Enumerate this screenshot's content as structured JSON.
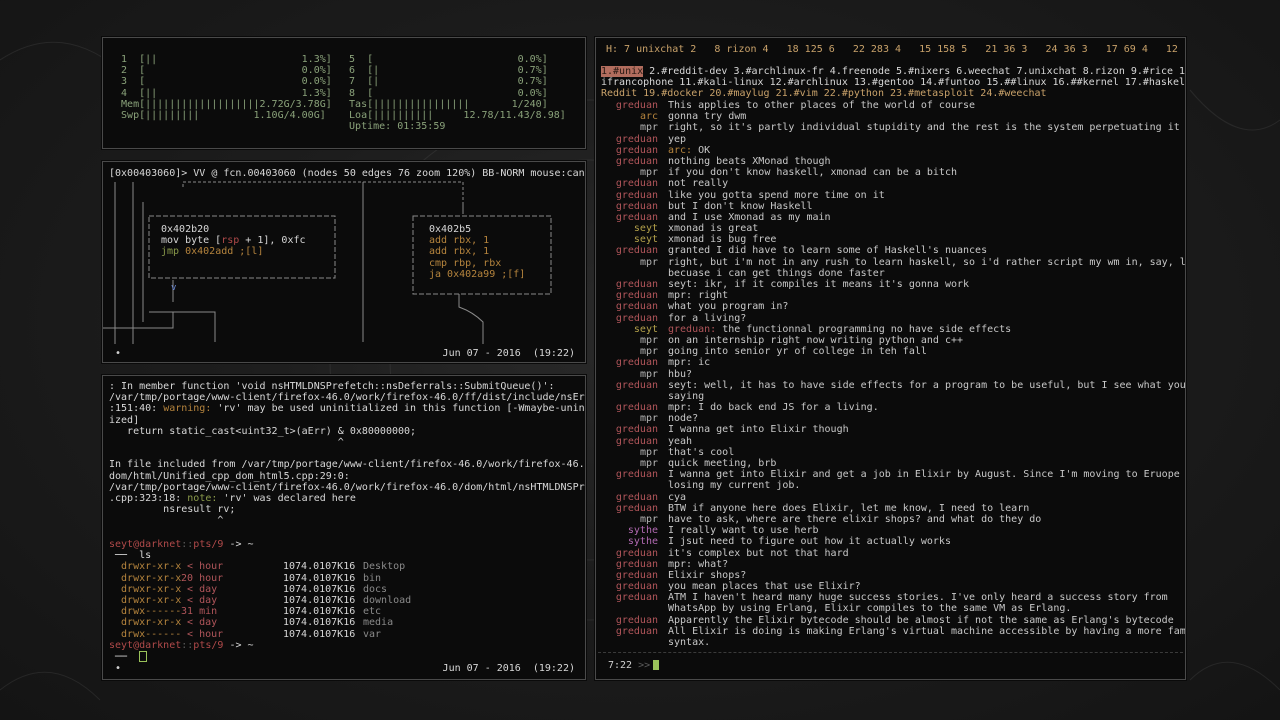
{
  "htop": {
    "rows": [
      {
        "left": "  1  [||                        1.3%]",
        "right": "  5  [                        0.0%]"
      },
      {
        "left": "  2  [                          0.0%]",
        "right": "  6  [|                       0.7%]"
      },
      {
        "left": "  3  [                          0.0%]",
        "right": "  7  [|                       0.7%]"
      },
      {
        "left": "  4  [||                        1.3%]",
        "right": "  8  [                        0.0%]"
      },
      {
        "left": "  Mem[|||||||||||||||||||2.72G/3.78G]",
        "right": "  Tas[||||||||||||||||       1/240]"
      },
      {
        "left": "  Swp[|||||||||         1.10G/4.00G]",
        "right": "  Loa[||||||||||     12.78/11.43/8.98]"
      },
      {
        "left": "",
        "right": "  Uptime: 01:35:59"
      }
    ]
  },
  "r2": {
    "header": "[0x00403060]> VV @ fcn.00403060 (nodes 50 edges 76 zoom 120%) BB-NORM mouse:canvas-y",
    "node1": {
      "addr": "0x402b20",
      "line1a": "mov byte [",
      "line1b": "rsp",
      "line1c": " + 1], 0xfc",
      "line2a": "jmp ",
      "line2b": "0x402add ;[l]"
    },
    "node2": {
      "addr": "0x402b5",
      "l1": "add rbx, 1",
      "l2": "add rbx, 1",
      "l3": "cmp rbp, rbx",
      "l4": "ja 0x402a99 ;[f]"
    },
    "status_left": "•",
    "status_right": "Jun 07 - 2016  (19:22)"
  },
  "term": {
    "lines": [
      {
        "text": ": In member function 'void nsHTMLDNSPrefetch::nsDeferrals::SubmitQueue()':"
      },
      {
        "text": "/var/tmp/portage/www-client/firefox-46.0/work/firefox-46.0/ff/dist/include/nsError.h"
      },
      {
        "pre": ":151:40: ",
        "warn": "warning:",
        "post": " 'rv' may be used uninitialized in this function [-Wmaybe-uninitial"
      },
      {
        "text": "ized]"
      },
      {
        "text": "   return static_cast<uint32_t>(aErr) & 0x80000000;"
      },
      {
        "text": "                                      ^"
      },
      {
        "text": "In file included from /var/tmp/portage/www-client/firefox-46.0/work/firefox-46.0/ff/"
      },
      {
        "text": "dom/html/Unified_cpp_dom_html5.cpp:29:0:"
      },
      {
        "text": "/var/tmp/portage/www-client/firefox-46.0/work/firefox-46.0/dom/html/nsHTMLDNSPrefetch"
      },
      {
        "pre": ".cpp:323:18: ",
        "note": "note:",
        "post": " 'rv' was declared here"
      },
      {
        "text": "         nsresult rv;"
      },
      {
        "text": "                  ^"
      }
    ],
    "prompt1": {
      "user": "seyt@darknet",
      "sep": "::",
      "path": "pts/9",
      "tail": "-> ~"
    },
    "prompt_cmd": " ──  ls",
    "ls": [
      {
        "perm": "  drwxr-xr-x",
        "age": "  < hour",
        "size": "1074.0107K16",
        "name": "Desktop"
      },
      {
        "perm": "  drwxr-xr-x",
        "age": " 20 hour",
        "size": "1074.0107K16",
        "name": "bin"
      },
      {
        "perm": "  drwxr-xr-x",
        "age": "  < day",
        "size": "1074.0107K16",
        "name": "docs"
      },
      {
        "perm": "  drwxr-xr-x",
        "age": "  < day",
        "size": "1074.0107K16",
        "name": "download"
      },
      {
        "perm": "  drwx------",
        "age": " 31 min",
        "size": "1074.0107K16",
        "name": "etc"
      },
      {
        "perm": "  drwxr-xr-x",
        "age": "  < day",
        "size": "1074.0107K16",
        "name": "media"
      },
      {
        "perm": "  drwx------",
        "age": "  < hour",
        "size": "1074.0107K16",
        "name": "var"
      }
    ],
    "prompt2": {
      "user": "seyt@darknet",
      "sep": "::",
      "path": "pts/9",
      "tail": "-> ~"
    },
    "prompt2_cmd": " ──  ",
    "status_left": "•",
    "status_right": "Jun 07 - 2016  (19:22)"
  },
  "irc": {
    "topbar": "H: 7 unixchat 2   8 rizon 4   18 125 6   22 283 4   15 158 5   21 36 3   24 36 3   17 69 4   12 1 ++",
    "channels_line1": [
      {
        "label": "1.#unix",
        "active": true
      },
      {
        "label": " 2.#reddit-dev"
      },
      {
        "label": " 3.#archlinux-fr"
      },
      {
        "label": " 4.freenode"
      },
      {
        "label": " 5.#nixers"
      },
      {
        "label": " 6.weechat"
      },
      {
        "label": " 7.unixchat"
      },
      {
        "label": " 8.rizon"
      },
      {
        "label": " 9.#rice"
      },
      {
        "label": " 10.#kal"
      }
    ],
    "channels_line2": "ifrancophone 11.#kali-linux 12.#archlinux 13.#gentoo 14.#funtoo 15.##linux 16.##kernel 17.#haskell 18.#",
    "channels_line3": "Reddit 19.#docker 20.#maylug 21.#vim 22.#python 23.#metasploit 24.#weechat",
    "messages": [
      {
        "nick": "greduan",
        "text": "This applies to other places of the world of course"
      },
      {
        "nick": "arc",
        "text": "gonna try dwm"
      },
      {
        "nick": "mpr",
        "text": "right, so it's partly individual stupidity and the rest is the system perpetuating it"
      },
      {
        "nick": "greduan",
        "text": "yep"
      },
      {
        "nick": "greduan",
        "hl": "arc:",
        "text": " OK"
      },
      {
        "nick": "greduan",
        "text": "nothing beats XMonad though"
      },
      {
        "nick": "mpr",
        "text": "if you don't know haskell, xmonad can be a bitch"
      },
      {
        "nick": "greduan",
        "text": "not really"
      },
      {
        "nick": "greduan",
        "text": "like you gotta spend more time on it"
      },
      {
        "nick": "greduan",
        "text": "but I don't know Haskell"
      },
      {
        "nick": "greduan",
        "text": "and I use Xmonad as my main"
      },
      {
        "nick": "seyt",
        "text": "xmonad is great"
      },
      {
        "nick": "seyt",
        "text": "xmonad is bug free"
      },
      {
        "nick": "greduan",
        "text": "granted I did have to learn some of Haskell's nuances"
      },
      {
        "nick": "mpr",
        "text": "right, but i'm not in any rush to learn haskell, so i'd rather script my wm in, say, lisp",
        "cont": "becuase i can get things done faster"
      },
      {
        "nick": "greduan",
        "text": "seyt: ikr, if it compiles it means it's gonna work"
      },
      {
        "nick": "greduan",
        "text": "mpr: right"
      },
      {
        "nick": "greduan",
        "text": "what you program in?"
      },
      {
        "nick": "greduan",
        "text": "for a living?"
      },
      {
        "nick": "seyt",
        "hl": "greduan:",
        "text": " the functionnal programming no have side effects"
      },
      {
        "nick": "mpr",
        "text": "on an internship right now writing python and c++"
      },
      {
        "nick": "mpr",
        "text": "going into senior yr of college in teh fall"
      },
      {
        "nick": "greduan",
        "text": "mpr: ic"
      },
      {
        "nick": "mpr",
        "text": "hbu?"
      },
      {
        "nick": "greduan",
        "text": "seyt: well, it has to have side effects for a program to be useful, but I see what you're",
        "cont": "saying"
      },
      {
        "nick": "greduan",
        "text": "mpr: I do back end JS for a living."
      },
      {
        "nick": "mpr",
        "text": "node?"
      },
      {
        "nick": "greduan",
        "text": "I wanna get into Elixir though"
      },
      {
        "nick": "greduan",
        "text": "yeah"
      },
      {
        "nick": "mpr",
        "text": "that's cool"
      },
      {
        "nick": "mpr",
        "text": "quick meeting, brb"
      },
      {
        "nick": "greduan",
        "text": "I wanna get into Elixir and get a job in Elixir by August. Since I'm moving to Eruope I'm",
        "cont": "losing my current job."
      },
      {
        "nick": "greduan",
        "text": "cya"
      },
      {
        "nick": "greduan",
        "text": "BTW if anyone here does Elixir, let me know, I need to learn"
      },
      {
        "nick": "mpr",
        "text": "have to ask, where are there elixir shops? and what do they do"
      },
      {
        "nick": "sythe",
        "text": "I really want to use herb"
      },
      {
        "nick": "sythe",
        "text": "I jsut need to figure out how it actually works"
      },
      {
        "nick": "greduan",
        "text": "it's complex but not that hard"
      },
      {
        "nick": "greduan",
        "text": "mpr: what?"
      },
      {
        "nick": "greduan",
        "text": "Elixir shops?"
      },
      {
        "nick": "greduan",
        "text": "you mean places that use Elixir?"
      },
      {
        "nick": "greduan",
        "text": "ATM I haven't heard many huge success stories. I've only heard a success story from",
        "cont": "WhatsApp by using Erlang, Elixir compiles to the same VM as Erlang."
      },
      {
        "nick": "greduan",
        "text": "Apparently the Elixir bytecode should be almost if not the same as Erlang's bytecode"
      },
      {
        "nick": "greduan",
        "text": "All Elixir is doing is making Erlang's virtual machine accessible by having a more familiar",
        "cont": "syntax."
      }
    ],
    "input_time": "7:22",
    "input_prompt": ">>"
  }
}
